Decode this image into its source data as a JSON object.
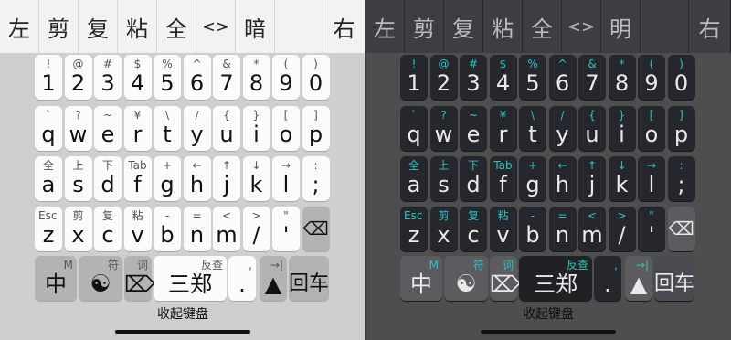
{
  "panes": [
    {
      "theme": "light",
      "toolbar": [
        "左",
        "剪",
        "复",
        "粘",
        "全",
        "<>",
        "暗",
        "",
        "右"
      ],
      "collapse_label": "收起键盘"
    },
    {
      "theme": "dark",
      "toolbar": [
        "左",
        "剪",
        "复",
        "粘",
        "全",
        "<>",
        "明",
        "",
        "右"
      ],
      "collapse_label": "收起键盘"
    }
  ],
  "rows": {
    "numbers": [
      {
        "m": "1",
        "h": "!"
      },
      {
        "m": "2",
        "h": "@"
      },
      {
        "m": "3",
        "h": "#"
      },
      {
        "m": "4",
        "h": "$"
      },
      {
        "m": "5",
        "h": "%"
      },
      {
        "m": "6",
        "h": "^"
      },
      {
        "m": "7",
        "h": "&"
      },
      {
        "m": "8",
        "h": "*"
      },
      {
        "m": "9",
        "h": "("
      },
      {
        "m": "0",
        "h": ")"
      }
    ],
    "top": [
      {
        "m": "q",
        "h": "`"
      },
      {
        "m": "w",
        "h": "?"
      },
      {
        "m": "e",
        "h": "~"
      },
      {
        "m": "r",
        "h": "¥"
      },
      {
        "m": "t",
        "h": "\\"
      },
      {
        "m": "y",
        "h": "/"
      },
      {
        "m": "u",
        "h": "{"
      },
      {
        "m": "i",
        "h": "}"
      },
      {
        "m": "o",
        "h": "["
      },
      {
        "m": "p",
        "h": "]"
      }
    ],
    "home": [
      {
        "m": "a",
        "h": "全"
      },
      {
        "m": "s",
        "h": "上"
      },
      {
        "m": "d",
        "h": "下"
      },
      {
        "m": "f",
        "h": "Tab"
      },
      {
        "m": "g",
        "h": "+"
      },
      {
        "m": "h",
        "h": "←"
      },
      {
        "m": "j",
        "h": "↑"
      },
      {
        "m": "k",
        "h": "↓"
      },
      {
        "m": "l",
        "h": "→"
      },
      {
        "m": ";",
        "h": ":"
      }
    ],
    "bottom": [
      {
        "m": "z",
        "h": "Esc"
      },
      {
        "m": "x",
        "h": "剪"
      },
      {
        "m": "c",
        "h": "复"
      },
      {
        "m": "v",
        "h": "粘"
      },
      {
        "m": "b",
        "h": "-"
      },
      {
        "m": "n",
        "h": "="
      },
      {
        "m": "m",
        "h": "<"
      },
      {
        "m": "/",
        "h": ">"
      },
      {
        "m": "'",
        "h": "\""
      },
      {
        "m": "⌫",
        "h": ""
      }
    ],
    "last": [
      {
        "id": "lang",
        "m": "中",
        "h": "M"
      },
      {
        "id": "symbol",
        "m": "☯",
        "h": "符"
      },
      {
        "id": "word",
        "m": "⌦",
        "h": "词"
      },
      {
        "id": "space",
        "m": "三郑",
        "h": "反查"
      },
      {
        "id": "punct",
        "m": ".",
        "h": ","
      },
      {
        "id": "shift",
        "m": "▲",
        "h": "→|"
      },
      {
        "id": "enter",
        "m": "回车",
        "h": ""
      }
    ]
  }
}
